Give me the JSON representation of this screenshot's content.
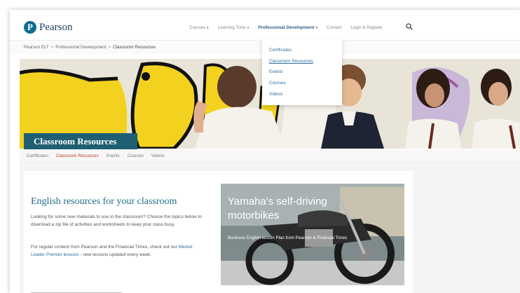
{
  "brand": {
    "logo_mark": "P",
    "name": "Pearson",
    "accent": "#1e5f73",
    "link_color": "#2f6fa0",
    "active_tab_color": "#c0392b"
  },
  "nav": {
    "items": [
      {
        "label": "Courses",
        "has_caret": true
      },
      {
        "label": "Learning Tools",
        "has_caret": true
      },
      {
        "label": "Professional Development",
        "has_caret": true,
        "active": true
      },
      {
        "label": "Contact",
        "has_caret": false
      },
      {
        "label": "Login & Register",
        "has_caret": false
      }
    ],
    "caret": "▾",
    "search_icon": "search-icon"
  },
  "breadcrumb": {
    "items": [
      "Pearson ELT",
      "Professional Development",
      "Classroom Resources"
    ],
    "separator": ">"
  },
  "dropdown": {
    "items": [
      "Certificates",
      "Classroom Resources",
      "Events",
      "Courses",
      "Videos"
    ],
    "hovered_index": 1
  },
  "hero": {
    "title": "Classroom Resources"
  },
  "subtabs": {
    "items": [
      "Certificates",
      "Classroom Resources",
      "Events",
      "Courses",
      "Videos"
    ],
    "active_index": 1
  },
  "card": {
    "title": "English resources for your classroom",
    "p1": "Looking for some new materials to use in the classroom? Choose the topics below to download a zip file of activities and worksheets to keep your class busy.",
    "p2_prefix": "For regular content from Pearson and the Financial Times, check out our",
    "p2_link": "Market Leader Premier lessons",
    "p2_suffix": " - new lessons updated every week."
  },
  "feature": {
    "title": "Yamaha's self-driving motorbikes",
    "subtitle": "Business English lesson Plan from Pearson & Financial Times"
  }
}
